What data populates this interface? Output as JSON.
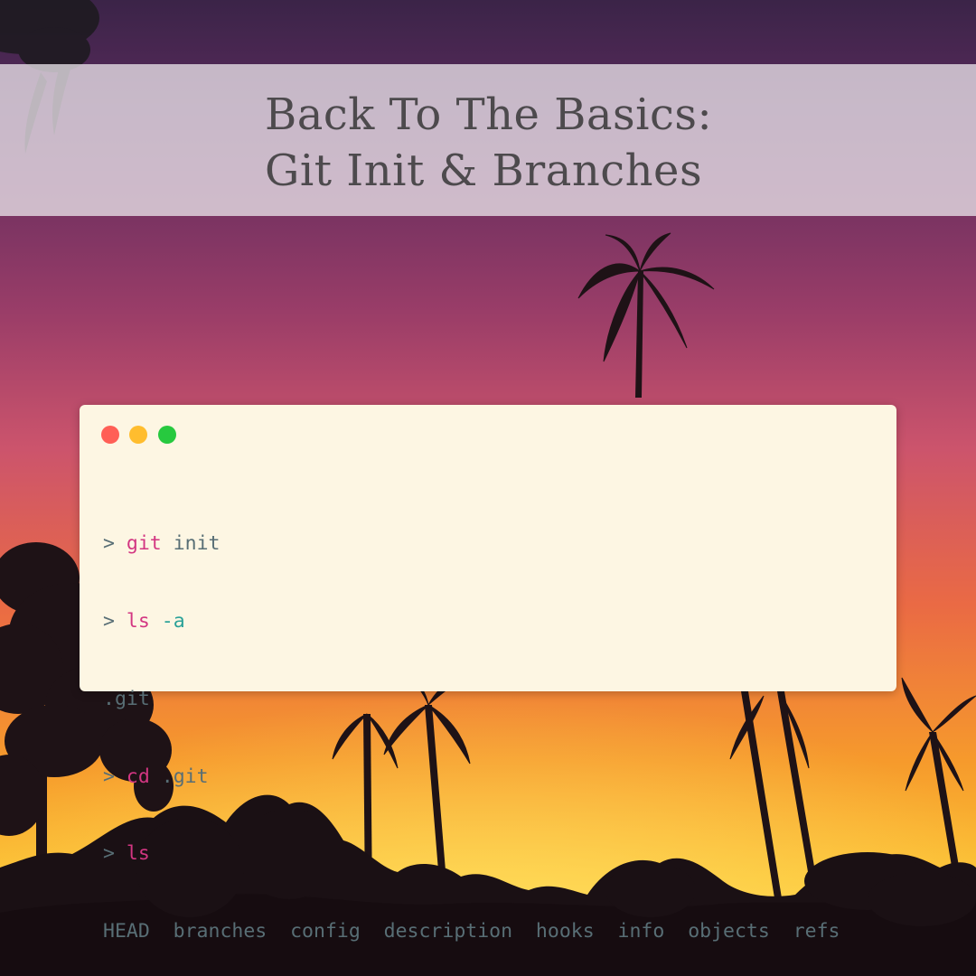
{
  "title": {
    "line1": "Back To The Basics:",
    "line2": "Git Init & Branches"
  },
  "colors": {
    "sky_top": "#3a2448",
    "sky_mid": "#c5506d",
    "sky_low": "#f08a2a",
    "sky_horizon": "#ffd03a",
    "silhouette": "#1e1216",
    "terminal_bg": "#fdf6e3",
    "command": "#d33682",
    "flag": "#2aa198",
    "text": "#586e75",
    "dot_red": "#ff5f56",
    "dot_yellow": "#ffbd2e",
    "dot_green": "#27c93f"
  },
  "terminal": {
    "window_controls": {
      "close_icon": "close-dot",
      "minimize_icon": "minimize-dot",
      "maximize_icon": "maximize-dot"
    },
    "lines": [
      {
        "prompt": ">",
        "command": "git",
        "flag": "",
        "args": "init"
      },
      {
        "prompt": ">",
        "command": "ls",
        "flag": "-a",
        "args": ""
      },
      {
        "output": ".git"
      },
      {
        "prompt": ">",
        "command": "cd",
        "flag": "",
        "args": ".git"
      },
      {
        "prompt": ">",
        "command": "ls",
        "flag": "",
        "args": ""
      },
      {
        "output": "HEAD  branches  config  description  hooks  info  objects  refs"
      }
    ]
  }
}
